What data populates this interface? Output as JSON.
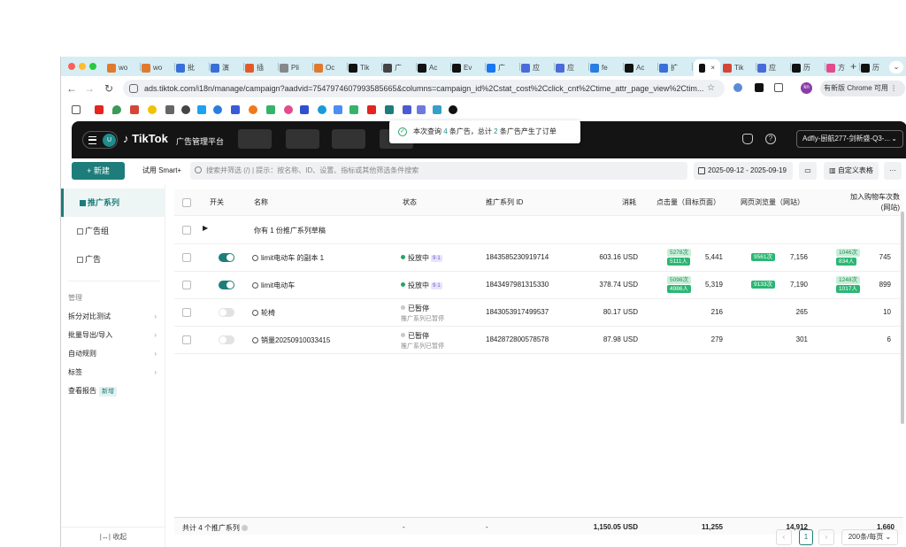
{
  "browser": {
    "tabs": [
      "wo",
      "wo",
      "批",
      "演",
      "插",
      "Pli",
      "Oc",
      "Tik",
      "广",
      "Ac",
      "Ev",
      "广",
      "应",
      "应",
      "fe",
      "Ac",
      "扩",
      "",
      "Tik",
      "应",
      "历",
      "方",
      "历"
    ],
    "active_tab_index": 17,
    "url": "ads.tiktok.com/i18n/manage/campaign?aadvid=7547974607993585665&columns=campaign_id%2Cstat_cost%2Cclick_cnt%2Ctime_attr_page_view%2Ctim...",
    "update_button": "有新版 Chrome 可用",
    "profile_initials": "kn"
  },
  "app": {
    "brand": "TikTok",
    "brand_sub": "广告管理平台",
    "user_initial": "U",
    "account": "Adfly-厨航277-剑新盛-Q3-...",
    "toast": {
      "prefix": "本次查询",
      "ads_count": "4",
      "middle": "条广告，总计",
      "order_count": "2",
      "suffix": "条广告产生了订单"
    }
  },
  "toolbar": {
    "new_label": "+ 新建",
    "try_smart": "试用 Smart+",
    "search_placeholder": "搜索并筛选 (/) | 提示：按名称、ID、设置、指标或其他筛选条件搜索",
    "date_range": "2025-09-12 - 2025-09-19",
    "custom_columns": "自定义表格",
    "more": "···"
  },
  "sidebar": {
    "items": [
      {
        "label": "推广系列",
        "active": true
      },
      {
        "label": "广告组",
        "active": false
      },
      {
        "label": "广告",
        "active": false
      }
    ],
    "section": "管理",
    "subitems": [
      {
        "label": "拆分对比测试",
        "chevron": true
      },
      {
        "label": "批量导出/导入",
        "chevron": true
      },
      {
        "label": "自动规则",
        "chevron": true
      },
      {
        "label": "标签",
        "chevron": true
      },
      {
        "label": "查看报告",
        "badge": "新增"
      }
    ],
    "collapse": "收起"
  },
  "table": {
    "headers": {
      "switch": "开关",
      "name": "名称",
      "status": "状态",
      "id": "推广系列 ID",
      "cost": "消耗",
      "clicks": "点击量（目标页面）",
      "views": "网页浏览量（网站）",
      "cart": "加入购物车次数",
      "cart2": "(网站)"
    },
    "draft_row": "你有 1 份推广系列草稿",
    "rows": [
      {
        "on": true,
        "name": "limit电动车 的副本 1",
        "status": "投放中",
        "status_badge": "9·1",
        "status_sub": "",
        "id": "1843585230919714",
        "cost": "603.16 USD",
        "clicks": "5,441",
        "clicks_p1": "5278次",
        "clicks_p2": "5111人",
        "views": "7,156",
        "views_p1": "9561次",
        "cart": "745",
        "cart_p1": "1046次",
        "cart_p2": "834人"
      },
      {
        "on": true,
        "name": "limit电动车",
        "status": "投放中",
        "status_badge": "9·1",
        "status_sub": "",
        "id": "1843497981315330",
        "cost": "378.74 USD",
        "clicks": "5,319",
        "clicks_p1": "5098次",
        "clicks_p2": "4986人",
        "views": "7,190",
        "views_p1": "9133次",
        "cart": "899",
        "cart_p1": "1248次",
        "cart_p2": "1017人"
      },
      {
        "on": false,
        "name": "轮椅",
        "status": "已暂停",
        "status_badge": "",
        "status_sub": "推广系列已暂停",
        "id": "1843053917499537",
        "cost": "80.17 USD",
        "clicks": "216",
        "views": "265",
        "cart": "10"
      },
      {
        "on": false,
        "name": "销量20250910033415",
        "status": "已暂停",
        "status_badge": "",
        "status_sub": "推广系列已暂停",
        "id": "1842872800578578",
        "cost": "87.98 USD",
        "clicks": "279",
        "views": "301",
        "cart": "6"
      }
    ],
    "footer": {
      "label": "共计 4 个推广系列",
      "status": "-",
      "id": "-",
      "cost": "1,150.05 USD",
      "clicks": "11,255",
      "views": "14,912",
      "cart": "1,660"
    },
    "pager": {
      "page": "1",
      "page_size": "200条/每页"
    }
  },
  "colors": {
    "accent": "#1d7d7a",
    "header_bg": "#141414",
    "running_dot": "#27a36b",
    "paused_dot": "#c8c8c8"
  }
}
